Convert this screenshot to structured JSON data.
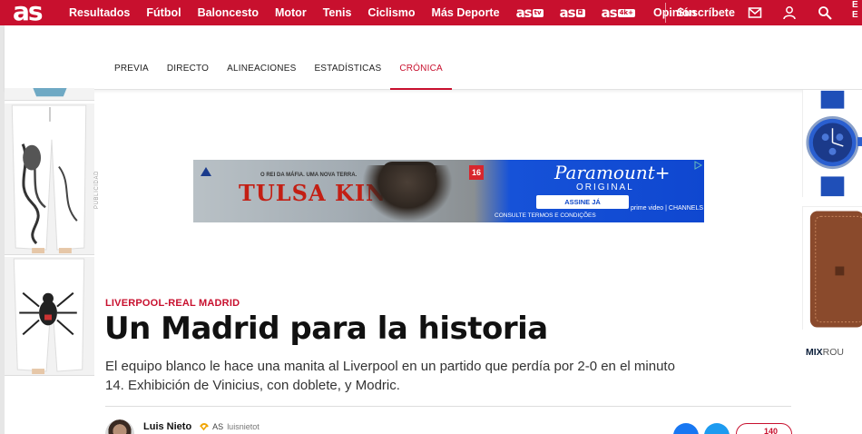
{
  "header": {
    "logo": "as",
    "nav": [
      "Resultados",
      "Fútbol",
      "Baloncesto",
      "Motor",
      "Tenis",
      "Ciclismo",
      "Más Deporte"
    ],
    "brands": [
      {
        "name": "as",
        "tag": "tv"
      },
      {
        "name": "as",
        "tag": "◘"
      },
      {
        "name": "as",
        "tag": "4k+"
      }
    ],
    "opinion": "Opinión",
    "subscribe": "Suscríbete",
    "edition": "E E",
    "colors": {
      "brand_red": "#c8102e"
    }
  },
  "subnav": {
    "items": [
      "PREVIA",
      "DIRECTO",
      "ALINEACIONES",
      "ESTADÍSTICAS",
      "CRÓNICA"
    ],
    "active": "CRÓNICA"
  },
  "ad": {
    "label": "PUBLICIDAD",
    "banner": {
      "tagline": "O REI DA MÁFIA. UMA NOVA TERRA.",
      "title": "TULSA KING",
      "rating": "16",
      "brand": "Paramount+",
      "brand_sub": "ORIGINAL",
      "cta": "ASSINE JÁ",
      "terms": "CONSULTE TERMOS E CONDIÇÕES",
      "channel": "prime video | CHANNELS"
    }
  },
  "article": {
    "kicker": "LIVERPOOL-REAL MADRID",
    "headline": "Un Madrid para la historia",
    "summary": "El equipo blanco le hace una manita al Liverpool en un partido que perdía por 2-0 en el minuto 14. Exhibición de Vinicius, con doblete, y Modric.",
    "author": {
      "name": "Luis Nieto",
      "org": "AS",
      "handle": "luisnietot"
    },
    "comments_count": "140"
  },
  "right_rail": {
    "brand": "MIX",
    "brand_suffix": "ROU"
  }
}
